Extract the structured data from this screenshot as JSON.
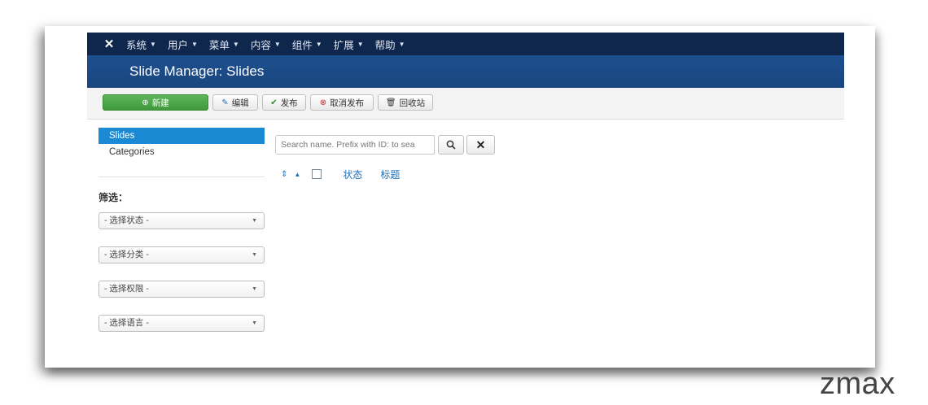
{
  "topnav": {
    "logo": "joomla-logo",
    "items": [
      {
        "label": "系统"
      },
      {
        "label": "用户"
      },
      {
        "label": "菜单"
      },
      {
        "label": "内容"
      },
      {
        "label": "组件"
      },
      {
        "label": "扩展"
      },
      {
        "label": "帮助"
      }
    ]
  },
  "header": {
    "title": "Slide Manager: Slides"
  },
  "toolbar": {
    "new_label": "新建",
    "edit_label": "编辑",
    "publish_label": "发布",
    "unpublish_label": "取消发布",
    "trash_label": "回收站"
  },
  "sidebar": {
    "links": [
      {
        "label": "Slides",
        "active": true
      },
      {
        "label": "Categories",
        "active": false
      }
    ],
    "filter_title": "筛选：",
    "filters": [
      {
        "selected": "- 选择状态 -"
      },
      {
        "selected": "- 选择分类 -"
      },
      {
        "selected": "- 选择权限 -"
      },
      {
        "selected": "- 选择语言 -"
      }
    ]
  },
  "search": {
    "placeholder": "Search name. Prefix with ID: to sea",
    "search_icon": "search-icon",
    "clear_icon": "close-icon"
  },
  "table": {
    "columns": [
      "状态",
      "标题"
    ]
  },
  "watermark": "zmax",
  "colors": {
    "topnav_bg": "#10274d",
    "header_bg": "#1a467e",
    "new_button": "#46a043",
    "active_link": "#1a8ad4",
    "link": "#1f6fb7"
  }
}
